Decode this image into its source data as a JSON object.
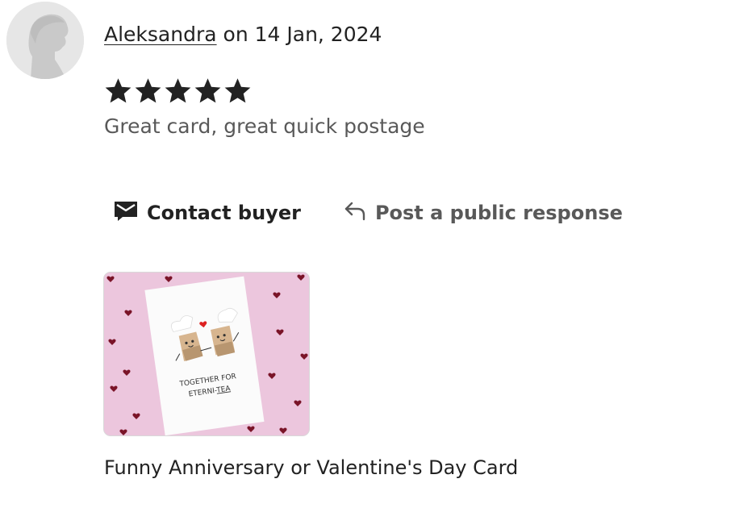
{
  "reviewer": {
    "name": "Aleksandra",
    "date_text": " on 14 Jan, 2024"
  },
  "rating": {
    "value": 5,
    "max": 5,
    "color": "#222222"
  },
  "review": {
    "text": "Great card, great quick postage"
  },
  "actions": {
    "contact_label": "Contact buyer",
    "contact_icon": "envelope-icon",
    "respond_label": "Post a public response",
    "respond_icon": "reply-arrow-icon"
  },
  "listing": {
    "card_text_line1": "TOGETHER FOR",
    "card_text_line2_prefix": "ETERNI-",
    "card_text_line2_suffix": "TEA",
    "title": "Funny Anniversary or Valentine's Day Card"
  },
  "colors": {
    "text": "#222222",
    "muted": "#595959",
    "thumb_bg": "#ecc6dd",
    "heart": "#7a1428"
  }
}
